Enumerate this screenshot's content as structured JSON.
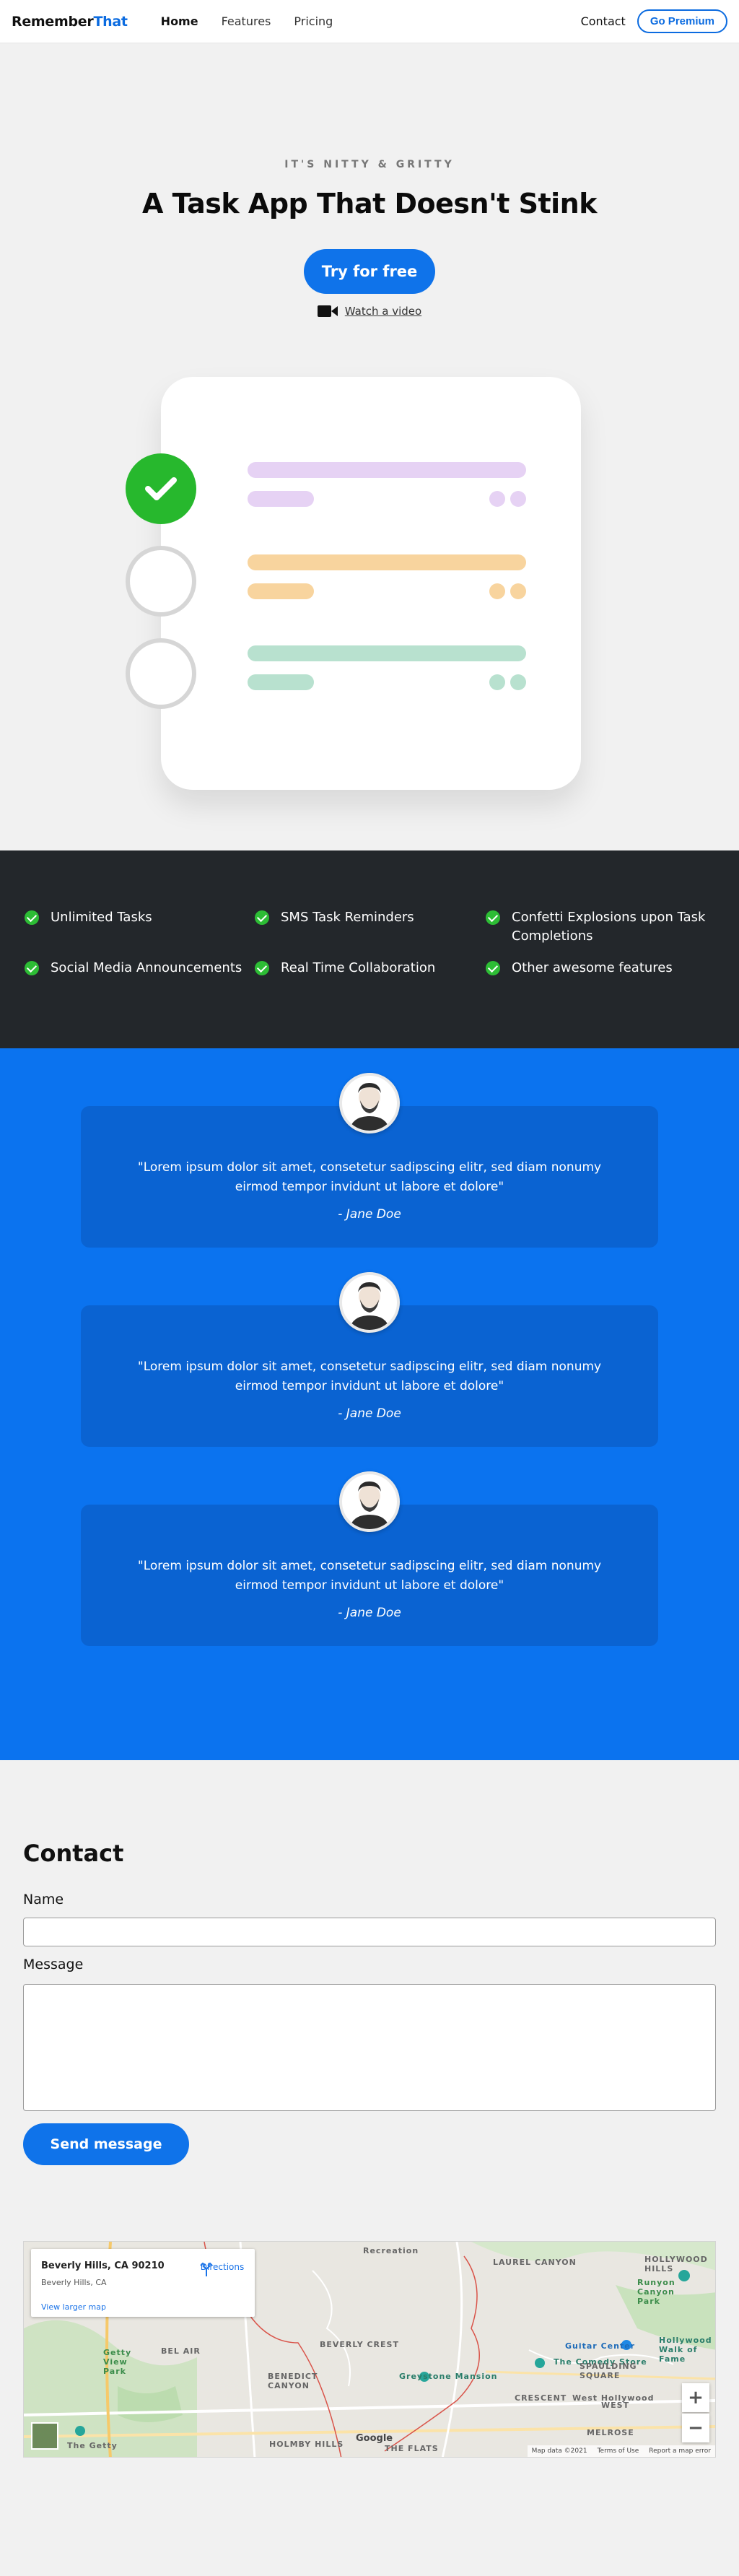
{
  "nav": {
    "brand_part1": "Remember",
    "brand_part2": "That",
    "links": [
      "Home",
      "Features",
      "Pricing"
    ],
    "contact": "Contact",
    "premium": "Go Premium"
  },
  "hero": {
    "eyebrow": "IT'S NITTY & GRITTY",
    "title": "A Task App That Doesn't Stink",
    "cta": "Try for free",
    "watch": "Watch a video"
  },
  "features": [
    "Unlimited Tasks",
    "SMS Task Reminders",
    "Confetti Explosions upon Task Completions",
    "Social Media Announcements",
    "Real Time Collaboration",
    "Other awesome features"
  ],
  "testimonials": [
    {
      "quote": "\"Lorem ipsum dolor sit amet, consetetur sadipscing elitr, sed diam nonumy eirmod tempor invidunt ut labore et dolore\"",
      "author": "- Jane Doe"
    },
    {
      "quote": "\"Lorem ipsum dolor sit amet, consetetur sadipscing elitr, sed diam nonumy eirmod tempor invidunt ut labore et dolore\"",
      "author": "- Jane Doe"
    },
    {
      "quote": "\"Lorem ipsum dolor sit amet, consetetur sadipscing elitr, sed diam nonumy eirmod tempor invidunt ut labore et dolore\"",
      "author": "- Jane Doe"
    }
  ],
  "contact": {
    "title": "Contact",
    "name_label": "Name",
    "name_value": "",
    "message_label": "Message",
    "message_value": "",
    "send": "Send message"
  },
  "map": {
    "address": "Beverly Hills, CA 90210",
    "sub": "Beverly Hills, CA",
    "larger": "View larger map",
    "directions": "Directions",
    "labels": [
      "Recreation",
      "LAUREL CANYON",
      "HOLLYWOOD HILLS",
      "Runyon Canyon Park",
      "BEL AIR",
      "Getty View Park",
      "BEVERLY CREST",
      "BENEDICT CANYON",
      "The Comedy Store",
      "Guitar Center",
      "SPAULDING SQUARE",
      "Greystone Mansion",
      "CRESCENT",
      "West Hollywood",
      "HOLMBY HILLS",
      "THE FLATS",
      "MELROSE",
      "The Getty",
      "WEST",
      "Hollywood Walk of Fame"
    ],
    "footer": [
      "Map data ©2021",
      "Terms of Use",
      "Report a map error"
    ],
    "zoom_in": "+",
    "zoom_out": "−",
    "google": "Google"
  },
  "colors": {
    "accent": "#0f73ea",
    "dark": "#23272b",
    "check": "#2dbd35",
    "testimonial_bg": "#0b73ef",
    "task_purple": "#e6d2f4",
    "task_orange": "#f8d49e",
    "task_green": "#b8e1cf"
  }
}
